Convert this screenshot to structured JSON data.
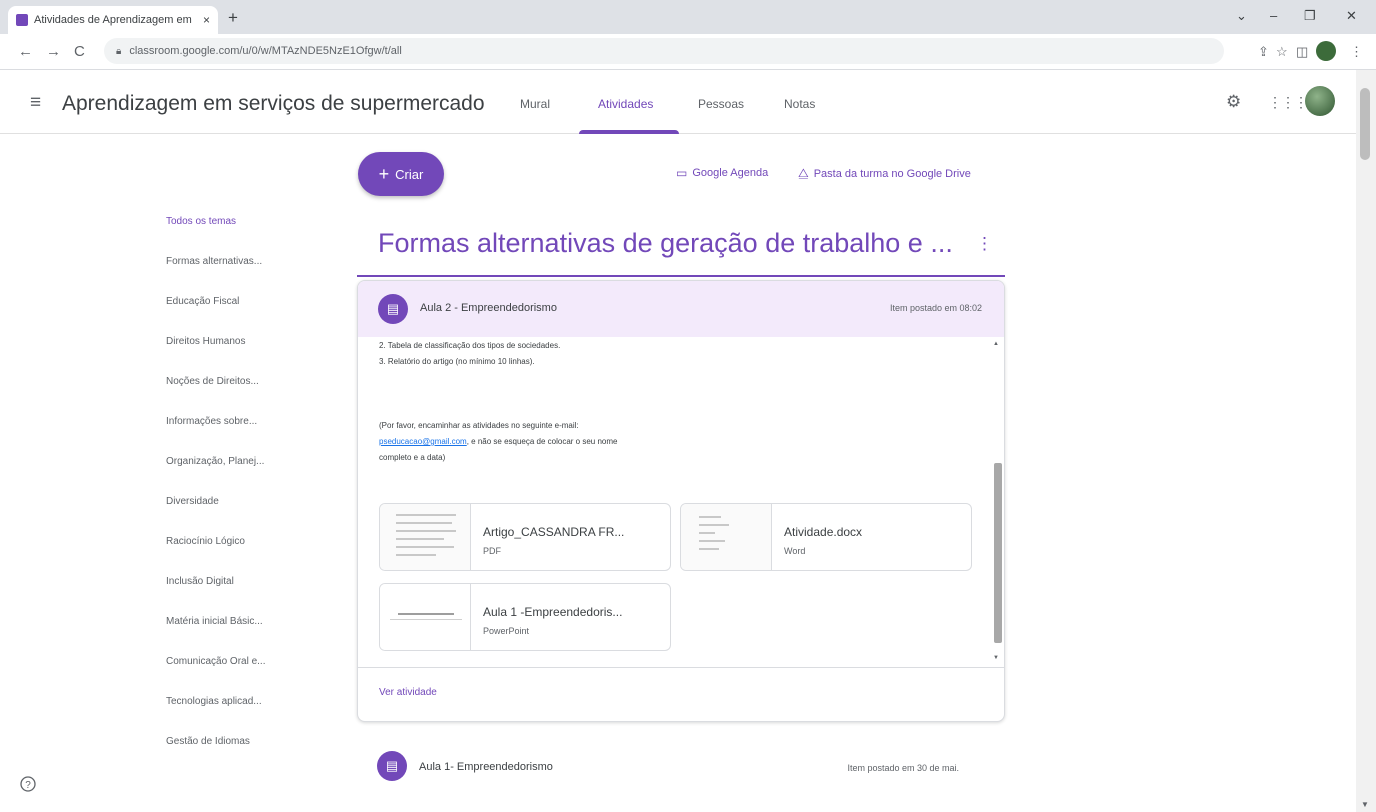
{
  "browser": {
    "tab_title": "Atividades de Aprendizagem em",
    "tab_close": "×",
    "new_tab": "+",
    "url": "classroom.google.com/u/0/w/MTAzNDE5NzE1Ofgw/t/all",
    "window_controls": [
      "⌄",
      "–",
      "❐",
      "✕"
    ],
    "nav": {
      "back": "←",
      "forward": "→",
      "reload": "C"
    },
    "toolbar_icons": {
      "share": "⇪",
      "star": "☆",
      "split": "◫"
    },
    "menu_dots": "⋮"
  },
  "app": {
    "class_title": "Aprendizagem em serviços de supermercado",
    "tabs": [
      {
        "label": "Mural",
        "active": false
      },
      {
        "label": "Atividades",
        "active": true
      },
      {
        "label": "Pessoas",
        "active": false
      },
      {
        "label": "Notas",
        "active": false
      }
    ],
    "icons": {
      "menu": "≡",
      "settings": "⚙",
      "apps": "⋮⋮⋮"
    }
  },
  "toolbar": {
    "create_label": "Criar",
    "create_icon": "+",
    "calendar_label": "Google Agenda",
    "calendar_icon": "▭",
    "drive_label": "Pasta da turma no Google Drive",
    "drive_icon": "⧋"
  },
  "topics": [
    {
      "label": "Todos os temas",
      "active": true
    },
    {
      "label": "Formas alternativas...",
      "active": false
    },
    {
      "label": "Educação Fiscal",
      "active": false
    },
    {
      "label": "Direitos Humanos",
      "active": false
    },
    {
      "label": "Noções de Direitos...",
      "active": false
    },
    {
      "label": "Informações sobre...",
      "active": false
    },
    {
      "label": "Organização, Planej...",
      "active": false
    },
    {
      "label": "Diversidade",
      "active": false
    },
    {
      "label": "Raciocínio Lógico",
      "active": false
    },
    {
      "label": "Inclusão Digital",
      "active": false
    },
    {
      "label": "Matéria inicial Básic...",
      "active": false
    },
    {
      "label": "Comunicação Oral e...",
      "active": false
    },
    {
      "label": "Tecnologias aplicad...",
      "active": false
    },
    {
      "label": "Gestão de Idiomas",
      "active": false
    }
  ],
  "section": {
    "title": "Formas alternativas de geração de trabalho e ...",
    "menu": "⋮"
  },
  "assignment": {
    "title": "Aula 2 - Empreendedorismo",
    "date": "Item postado em 08:02",
    "icon": "▤",
    "description": {
      "line1": "2. Tabela de  classificação dos tipos de sociedades.",
      "line2": "3. Relatório do artigo (no mínimo 10 linhas).",
      "line3": "(Por favor, encaminhar as atividades no seguinte e-mail:",
      "email": "pseducacao@gmail.com",
      "line4_rest": ", e não se esqueça de colocar o seu nome",
      "line5": "completo e a data)"
    },
    "attachments": [
      {
        "name": "Artigo_CASSANDRA FR...",
        "type": "PDF"
      },
      {
        "name": "Atividade.docx",
        "type": "Word"
      },
      {
        "name": "Aula 1 -Empreendedoris...",
        "type": "PowerPoint"
      }
    ],
    "view_link": "Ver atividade"
  },
  "next_assignment": {
    "title": "Aula 1- Empreendedorismo",
    "date": "Item postado em 30 de mai."
  },
  "help_icon": "?",
  "colors": {
    "accent": "#7248b9",
    "header_tint": "#f3eafb",
    "link_blue": "#1a73e8"
  }
}
